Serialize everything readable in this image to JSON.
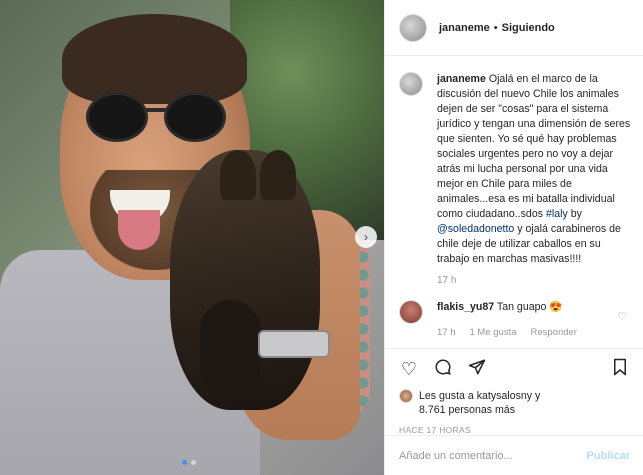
{
  "post": {
    "username": "jananeme",
    "separator": "•",
    "follow_status": "Siguiendo",
    "caption": {
      "username": "jananeme",
      "text_1": "Ojalá en el marco de la discusión del nuevo Chile los animales dejen de ser \"cosas\" para el sistema jurídico y tengan una dimensión de seres que sienten. Yo sé qué hay problemas sociales urgentes pero no voy a dejar atrás mi lucha personal por una vida mejor en Chile para miles de animales...esa es mi batalla individual como ciudadano..sdos ",
      "hashtag": "#laly",
      "text_2": " by ",
      "mention": "@soledadonetto",
      "text_3": " y ojalá carabineros de chile deje de utilizar caballos en su trabajo en marchas masivas!!!!",
      "time": "17 h"
    },
    "comment": {
      "username": "flakis_yu87",
      "text": "Tan guapo 😍",
      "time": "17 h",
      "likes": "1 Me gusta",
      "reply": "Responder"
    },
    "likes_line_1": "Les gusta a katysalosny y",
    "likes_line_2": "8.761 personas más",
    "posted": "HACE 17 HORAS",
    "comment_placeholder": "Añade un comentario...",
    "publish_label": "Publicar"
  },
  "icons": {
    "like": "heart-icon",
    "comment": "comment-icon",
    "share": "share-icon",
    "save": "bookmark-icon",
    "next": "chevron-right-icon"
  }
}
